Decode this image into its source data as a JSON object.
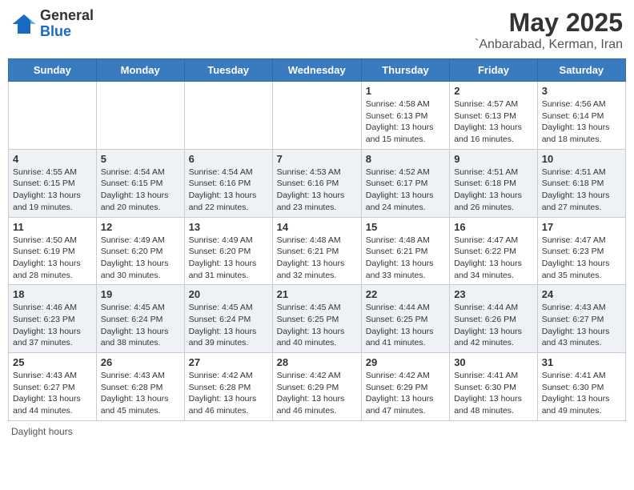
{
  "header": {
    "logo_line1": "General",
    "logo_line2": "Blue",
    "month_year": "May 2025",
    "location": "`Anbarabad, Kerman, Iran"
  },
  "weekdays": [
    "Sunday",
    "Monday",
    "Tuesday",
    "Wednesday",
    "Thursday",
    "Friday",
    "Saturday"
  ],
  "weeks": [
    [
      {
        "day": "",
        "info": ""
      },
      {
        "day": "",
        "info": ""
      },
      {
        "day": "",
        "info": ""
      },
      {
        "day": "",
        "info": ""
      },
      {
        "day": "1",
        "info": "Sunrise: 4:58 AM\nSunset: 6:13 PM\nDaylight: 13 hours and 15 minutes."
      },
      {
        "day": "2",
        "info": "Sunrise: 4:57 AM\nSunset: 6:13 PM\nDaylight: 13 hours and 16 minutes."
      },
      {
        "day": "3",
        "info": "Sunrise: 4:56 AM\nSunset: 6:14 PM\nDaylight: 13 hours and 18 minutes."
      }
    ],
    [
      {
        "day": "4",
        "info": "Sunrise: 4:55 AM\nSunset: 6:15 PM\nDaylight: 13 hours and 19 minutes."
      },
      {
        "day": "5",
        "info": "Sunrise: 4:54 AM\nSunset: 6:15 PM\nDaylight: 13 hours and 20 minutes."
      },
      {
        "day": "6",
        "info": "Sunrise: 4:54 AM\nSunset: 6:16 PM\nDaylight: 13 hours and 22 minutes."
      },
      {
        "day": "7",
        "info": "Sunrise: 4:53 AM\nSunset: 6:16 PM\nDaylight: 13 hours and 23 minutes."
      },
      {
        "day": "8",
        "info": "Sunrise: 4:52 AM\nSunset: 6:17 PM\nDaylight: 13 hours and 24 minutes."
      },
      {
        "day": "9",
        "info": "Sunrise: 4:51 AM\nSunset: 6:18 PM\nDaylight: 13 hours and 26 minutes."
      },
      {
        "day": "10",
        "info": "Sunrise: 4:51 AM\nSunset: 6:18 PM\nDaylight: 13 hours and 27 minutes."
      }
    ],
    [
      {
        "day": "11",
        "info": "Sunrise: 4:50 AM\nSunset: 6:19 PM\nDaylight: 13 hours and 28 minutes."
      },
      {
        "day": "12",
        "info": "Sunrise: 4:49 AM\nSunset: 6:20 PM\nDaylight: 13 hours and 30 minutes."
      },
      {
        "day": "13",
        "info": "Sunrise: 4:49 AM\nSunset: 6:20 PM\nDaylight: 13 hours and 31 minutes."
      },
      {
        "day": "14",
        "info": "Sunrise: 4:48 AM\nSunset: 6:21 PM\nDaylight: 13 hours and 32 minutes."
      },
      {
        "day": "15",
        "info": "Sunrise: 4:48 AM\nSunset: 6:21 PM\nDaylight: 13 hours and 33 minutes."
      },
      {
        "day": "16",
        "info": "Sunrise: 4:47 AM\nSunset: 6:22 PM\nDaylight: 13 hours and 34 minutes."
      },
      {
        "day": "17",
        "info": "Sunrise: 4:47 AM\nSunset: 6:23 PM\nDaylight: 13 hours and 35 minutes."
      }
    ],
    [
      {
        "day": "18",
        "info": "Sunrise: 4:46 AM\nSunset: 6:23 PM\nDaylight: 13 hours and 37 minutes."
      },
      {
        "day": "19",
        "info": "Sunrise: 4:45 AM\nSunset: 6:24 PM\nDaylight: 13 hours and 38 minutes."
      },
      {
        "day": "20",
        "info": "Sunrise: 4:45 AM\nSunset: 6:24 PM\nDaylight: 13 hours and 39 minutes."
      },
      {
        "day": "21",
        "info": "Sunrise: 4:45 AM\nSunset: 6:25 PM\nDaylight: 13 hours and 40 minutes."
      },
      {
        "day": "22",
        "info": "Sunrise: 4:44 AM\nSunset: 6:25 PM\nDaylight: 13 hours and 41 minutes."
      },
      {
        "day": "23",
        "info": "Sunrise: 4:44 AM\nSunset: 6:26 PM\nDaylight: 13 hours and 42 minutes."
      },
      {
        "day": "24",
        "info": "Sunrise: 4:43 AM\nSunset: 6:27 PM\nDaylight: 13 hours and 43 minutes."
      }
    ],
    [
      {
        "day": "25",
        "info": "Sunrise: 4:43 AM\nSunset: 6:27 PM\nDaylight: 13 hours and 44 minutes."
      },
      {
        "day": "26",
        "info": "Sunrise: 4:43 AM\nSunset: 6:28 PM\nDaylight: 13 hours and 45 minutes."
      },
      {
        "day": "27",
        "info": "Sunrise: 4:42 AM\nSunset: 6:28 PM\nDaylight: 13 hours and 46 minutes."
      },
      {
        "day": "28",
        "info": "Sunrise: 4:42 AM\nSunset: 6:29 PM\nDaylight: 13 hours and 46 minutes."
      },
      {
        "day": "29",
        "info": "Sunrise: 4:42 AM\nSunset: 6:29 PM\nDaylight: 13 hours and 47 minutes."
      },
      {
        "day": "30",
        "info": "Sunrise: 4:41 AM\nSunset: 6:30 PM\nDaylight: 13 hours and 48 minutes."
      },
      {
        "day": "31",
        "info": "Sunrise: 4:41 AM\nSunset: 6:30 PM\nDaylight: 13 hours and 49 minutes."
      }
    ]
  ],
  "footer": {
    "daylight_label": "Daylight hours"
  }
}
